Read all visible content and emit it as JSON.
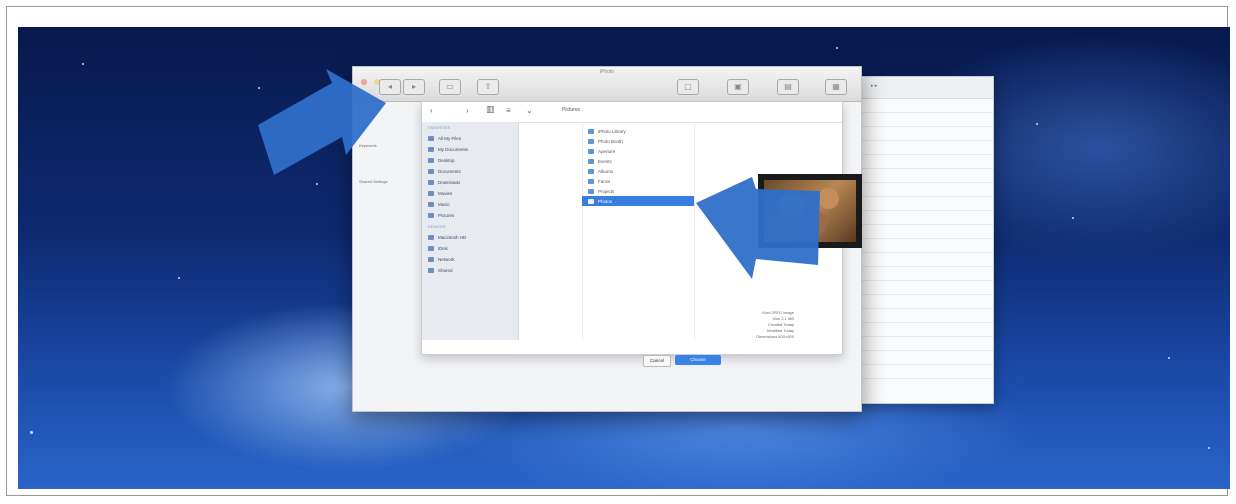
{
  "window": {
    "title": "iPhoto",
    "toolbar_buttons": [
      "back-icon",
      "forward-icon",
      "view-icon",
      "share-icon",
      "info-icon",
      "edit-icon",
      "effects-icon",
      "adjust-icon"
    ]
  },
  "nav": {
    "back": "‹",
    "forward": "›",
    "path": "Pictures"
  },
  "left_panel": {
    "items": [
      "Info",
      "Keywords",
      "Shared Settings"
    ]
  },
  "sidebar": {
    "favorites_header": "FAVORITES",
    "favorites": [
      "All My Files",
      "My Documents",
      "Desktop",
      "Documents",
      "Downloads",
      "Movies",
      "Music",
      "Pictures"
    ],
    "devices_header": "DEVICES",
    "devices": [
      "Macintosh HD",
      "iDisk",
      "Network",
      "Shared"
    ]
  },
  "folders": {
    "items": [
      "iPhoto Library",
      "Photo Booth",
      "Aperture",
      "Events",
      "Albums",
      "Faces",
      "Projects",
      "Photos"
    ],
    "selected_index": 7
  },
  "file_info": {
    "lines": [
      "Kind JPEG image",
      "Size 2.1 MB",
      "Created Today",
      "Modified Today",
      "Dimensions 800×600"
    ]
  },
  "buttons": {
    "cancel": "Cancel",
    "open": "Choose"
  },
  "colors": {
    "arrow": "#2f6fc9",
    "selection": "#3a7de0",
    "desktop": "#0d2a70"
  }
}
